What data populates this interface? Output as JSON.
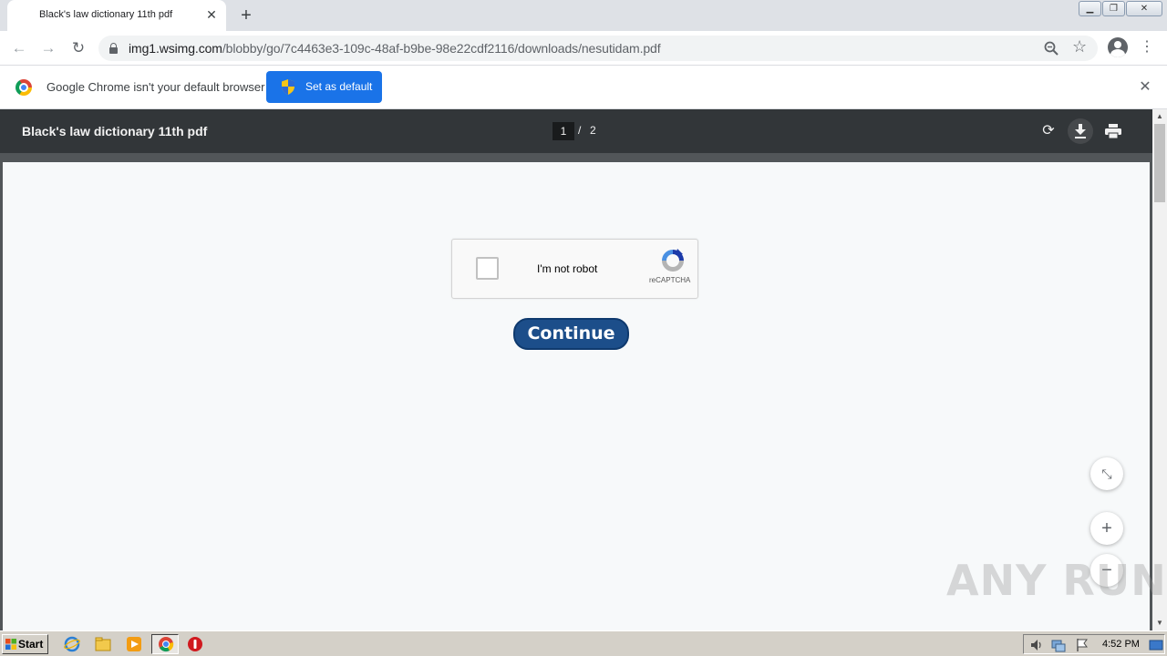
{
  "browser": {
    "tab_title": "Black's law dictionary 11th pdf",
    "url_host": "img1.wsimg.com",
    "url_path": "/blobby/go/7c4463e3-109c-48af-b9be-98e22cdf2116/downloads/nesutidam.pdf"
  },
  "infobar": {
    "message": "Google Chrome isn't your default browser",
    "button_label": "Set as default"
  },
  "pdf_viewer": {
    "title": "Black's law dictionary 11th pdf",
    "page_current": "1",
    "page_separator": "/",
    "page_total": "2"
  },
  "page": {
    "captcha_label": "I'm not robot",
    "captcha_brand": "reCAPTCHA",
    "continue_label": "Continue"
  },
  "watermark": "ANY RUN",
  "taskbar": {
    "start_label": "Start",
    "clock": "4:52 PM"
  },
  "colors": {
    "accent_blue": "#1a73e8",
    "pdf_toolbar": "#323639",
    "continue_button": "#1c4e8a"
  }
}
